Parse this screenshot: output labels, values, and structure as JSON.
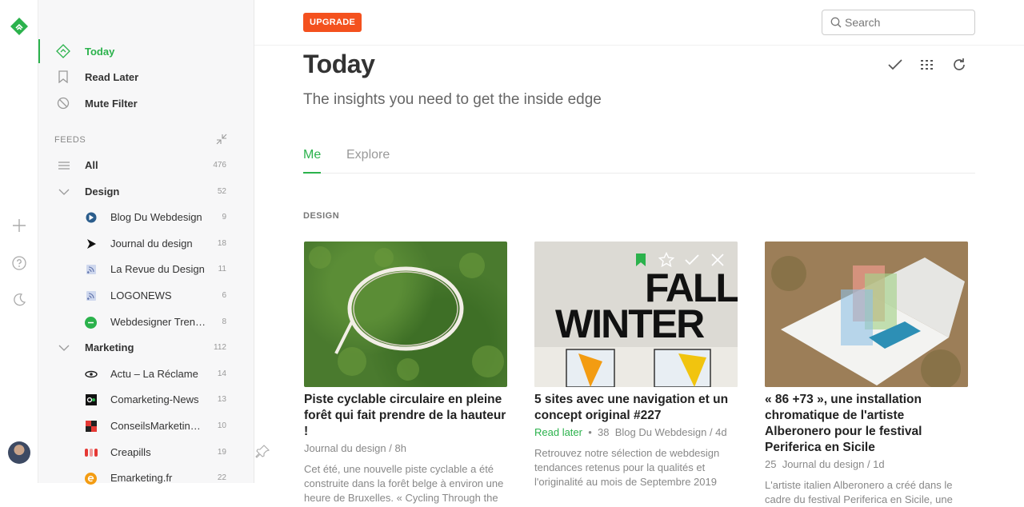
{
  "sidebar": {
    "nav": [
      {
        "label": "Today",
        "icon": "today-icon"
      },
      {
        "label": "Read Later",
        "icon": "bookmark-icon"
      },
      {
        "label": "Mute Filter",
        "icon": "mute-icon"
      }
    ],
    "feeds_header": "FEEDS",
    "all": {
      "name": "All",
      "count": "476"
    },
    "groups": [
      {
        "name": "Design",
        "count": "52",
        "feeds": [
          {
            "name": "Blog Du Webdesign",
            "count": "9"
          },
          {
            "name": "Journal du design",
            "count": "18"
          },
          {
            "name": "La Revue du Design",
            "count": "11"
          },
          {
            "name": "LOGONEWS",
            "count": "6"
          },
          {
            "name": "Webdesigner Tren…",
            "count": "8"
          }
        ]
      },
      {
        "name": "Marketing",
        "count": "112",
        "feeds": [
          {
            "name": "Actu – La Réclame",
            "count": "14"
          },
          {
            "name": "Comarketing-News",
            "count": "13"
          },
          {
            "name": "ConseilsMarketin…",
            "count": "10"
          },
          {
            "name": "Creapills",
            "count": "19"
          },
          {
            "name": "Emarketing.fr",
            "count": "22"
          }
        ]
      }
    ]
  },
  "topbar": {
    "upgrade": "UPGRADE",
    "search_placeholder": "Search"
  },
  "page": {
    "title": "Today",
    "subtitle": "The insights you need to get the inside edge",
    "tabs": [
      "Me",
      "Explore"
    ],
    "section": "DESIGN"
  },
  "cards": [
    {
      "title": "Piste cyclable circulaire en pleine forêt qui fait prendre de la hauteur !",
      "meta": "Journal du design / 8h",
      "snippet": "Cet été, une nouvelle piste cyclable a été construite dans la forêt belge à environ une heure de Bruxelles. « Cycling Through the"
    },
    {
      "title": "5 sites avec une navigation et un concept original #227",
      "read_later": "Read later",
      "count": "38",
      "meta": "Blog Du Webdesign / 4d",
      "image_text_1": "FALL",
      "image_text_2": "WINTER",
      "snippet": "Retrouvez notre sélection de webdesign tendances retenus pour la qualités et l'originalité au mois de Septembre 2019"
    },
    {
      "title": "« 86 +73 », une installation chromatique de l'artiste Alberonero pour le festival Periferica en Sicile",
      "count": "25",
      "meta": "Journal du design / 1d",
      "snippet": "L'artiste italien Alberonero a créé dans le cadre du festival Periferica en Sicile, une"
    }
  ],
  "colors": {
    "accent": "#2bb24c",
    "upgrade": "#f4511e"
  }
}
